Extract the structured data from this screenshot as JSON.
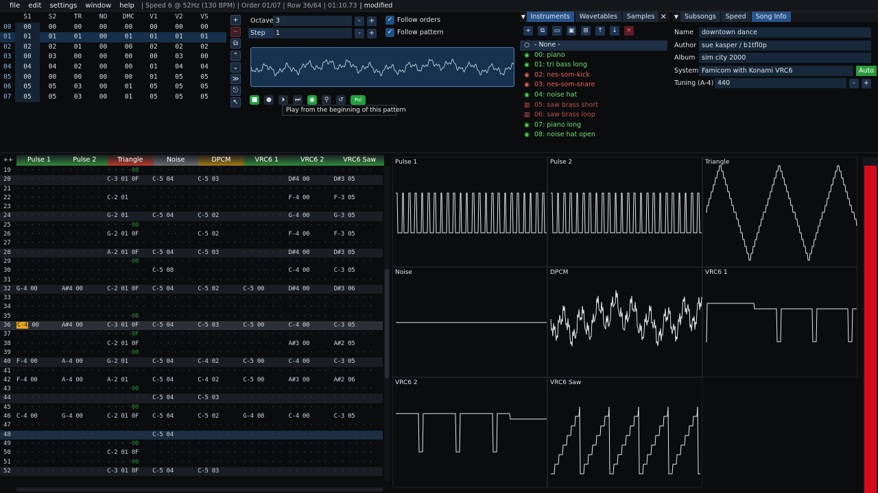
{
  "menubar": {
    "items": [
      "file",
      "edit",
      "settings",
      "window",
      "help"
    ],
    "status": "| Speed 6 @ 52Hz (130 BPM) | Order 01/07 | Row 36/64 | 01:10.73",
    "modified": "| modified"
  },
  "orders": {
    "headers": [
      "S1",
      "S2",
      "TR",
      "NO",
      "DMC",
      "V1",
      "V2",
      "VS"
    ],
    "rows": [
      {
        "n": "00",
        "v": [
          "00",
          "00",
          "00",
          "00",
          "00",
          "00",
          "00",
          "00"
        ]
      },
      {
        "n": "01",
        "v": [
          "01",
          "01",
          "01",
          "00",
          "01",
          "01",
          "01",
          "01"
        ]
      },
      {
        "n": "02",
        "v": [
          "02",
          "02",
          "01",
          "00",
          "00",
          "02",
          "02",
          "02"
        ]
      },
      {
        "n": "03",
        "v": [
          "00",
          "03",
          "00",
          "00",
          "00",
          "00",
          "03",
          "00"
        ]
      },
      {
        "n": "04",
        "v": [
          "04",
          "04",
          "02",
          "00",
          "00",
          "01",
          "04",
          "04"
        ]
      },
      {
        "n": "05",
        "v": [
          "00",
          "00",
          "00",
          "00",
          "00",
          "01",
          "05",
          "05"
        ]
      },
      {
        "n": "06",
        "v": [
          "05",
          "05",
          "03",
          "00",
          "01",
          "05",
          "05",
          "05"
        ]
      },
      {
        "n": "07",
        "v": [
          "05",
          "05",
          "03",
          "00",
          "01",
          "05",
          "05",
          "05"
        ]
      }
    ],
    "selected_row": 1
  },
  "order_buttons": [
    "+",
    "−",
    "⧉",
    "⌃",
    "⌄",
    "≫",
    "⎋",
    "↖"
  ],
  "octave": {
    "label": "Octave",
    "value": "3"
  },
  "step": {
    "label": "Step",
    "value": "1"
  },
  "follow_orders": "Follow orders",
  "follow_pattern": "Follow pattern",
  "tooltip": "Play from the beginning of this pattern",
  "transport": [
    "■",
    "●",
    "⏵",
    "⏭",
    "◉",
    "⚲",
    "↺",
    "Pol"
  ],
  "instr_tabs": [
    "Instruments",
    "Wavetables",
    "Samples"
  ],
  "instr_close": "✕",
  "instr_tools": [
    "+",
    "⧉",
    "▭",
    "▣",
    "⊞",
    "↑",
    "↓",
    "✕"
  ],
  "instruments": [
    {
      "icon": "○",
      "name": "- None -",
      "color": "#e8e8e8",
      "icolor": "#e8e8e8"
    },
    {
      "icon": "◉",
      "name": "00: piano",
      "color": "#6fe06f",
      "icolor": "#4cd94c"
    },
    {
      "icon": "◉",
      "name": "01: tri bass long",
      "color": "#6fe06f",
      "icolor": "#4cd94c"
    },
    {
      "icon": "◉",
      "name": "02: nes-som-kick",
      "color": "#e8605a",
      "icolor": "#e8605a"
    },
    {
      "icon": "◉",
      "name": "03: nes-som-snare",
      "color": "#e8605a",
      "icolor": "#e8605a"
    },
    {
      "icon": "◉",
      "name": "04: noise hat",
      "color": "#6fe06f",
      "icolor": "#4cd94c"
    },
    {
      "icon": "▥",
      "name": "05: saw brass short",
      "color": "#b8524a",
      "icolor": "#d9544a"
    },
    {
      "icon": "▥",
      "name": "06: saw brass loop",
      "color": "#b8524a",
      "icolor": "#d9544a"
    },
    {
      "icon": "◉",
      "name": "07: piano long",
      "color": "#6fe06f",
      "icolor": "#4cd94c"
    },
    {
      "icon": "◉",
      "name": "08: noise hat open",
      "color": "#6fe06f",
      "icolor": "#4cd94c"
    }
  ],
  "song_tabs": [
    "Subsongs",
    "Speed",
    "Song Info"
  ],
  "song_info": {
    "name_label": "Name",
    "name": "downtown dance",
    "author_label": "Author",
    "author": "sue kasper / b1tfl0p",
    "album_label": "Album",
    "album": "sim city 2000",
    "system_label": "System",
    "system": "Famicom with Konami VRC6",
    "auto": "Auto",
    "tuning_label": "Tuning (A-4)",
    "tuning": "440"
  },
  "pattern": {
    "corner": "++",
    "channels": [
      {
        "name": "Pulse 1",
        "color": "#2e8a3a"
      },
      {
        "name": "Pulse 2",
        "color": "#2e8a3a"
      },
      {
        "name": "Triangle",
        "color": "#b83a2c"
      },
      {
        "name": "Noise",
        "color": "#6a6e74"
      },
      {
        "name": "DPCM",
        "color": "#a07a10"
      },
      {
        "name": "VRC6 1",
        "color": "#2e8a3a"
      },
      {
        "name": "VRC6 2",
        "color": "#2e8a3a"
      },
      {
        "name": "VRC6 Saw",
        "color": "#2e8a3a"
      }
    ],
    "rows": [
      {
        "n": "19",
        "c": [
          "· · · · · ·",
          "· · · · · ·",
          "· · · ·08",
          "· · · · · ·",
          "· · · · · ·",
          "· · · · · ·",
          "· · · · · ·",
          "· · · · · ·"
        ]
      },
      {
        "n": "20",
        "c": [
          "· · · · · ·",
          "· · · · · ·",
          "C-3 01 0F",
          "C-5 04",
          "C-5 03",
          "· · · · · ·",
          "D#4 00",
          "D#3 05"
        ]
      },
      {
        "n": "21",
        "c": [
          "· · · · · ·",
          "· · · · · ·",
          "· · · · · ·",
          "· · · · · ·",
          "· · · · · ·",
          "· · · · · ·",
          "· · · · · ·",
          "· · · · · ·"
        ]
      },
      {
        "n": "22",
        "c": [
          "· · · · · ·",
          "· · · · · ·",
          "C-2 01",
          "· · · · · ·",
          "· · · · · ·",
          "· · · · · ·",
          "F-4 00",
          "F-3 05"
        ]
      },
      {
        "n": "23",
        "c": [
          "· · · · · ·",
          "· · · · · ·",
          "· · · · · ·",
          "· · · · · ·",
          "· · · · · ·",
          "· · · · · ·",
          "· · · · · ·",
          "· · · · · ·"
        ]
      },
      {
        "n": "24",
        "c": [
          "· · · · · ·",
          "· · · · · ·",
          "G-2 01",
          "C-5 04",
          "C-5 02",
          "· · · · · ·",
          "G-4 00",
          "G-3 05"
        ]
      },
      {
        "n": "25",
        "c": [
          "· · · · · ·",
          "· · · · · ·",
          "· · · ·00",
          "· · · · · ·",
          "· · · · · ·",
          "· · · · · ·",
          "· · · · · ·",
          "· · · · · ·"
        ]
      },
      {
        "n": "26",
        "c": [
          "· · · · · ·",
          "· · · · · ·",
          "G-2 01 0F",
          "· · · · · ·",
          "C-5 02",
          "· · · · · ·",
          "F-4 00",
          "F-3 05"
        ]
      },
      {
        "n": "27",
        "c": [
          "· · · · · ·",
          "· · · · · ·",
          "· · · · · ·",
          "· · · · · ·",
          "· · · · · ·",
          "· · · · · ·",
          "· · · · · ·",
          "· · · · · ·"
        ]
      },
      {
        "n": "28",
        "c": [
          "· · · · · ·",
          "· · · · · ·",
          "A-2 01 0F",
          "C-5 04",
          "C-5 03",
          "· · · · · ·",
          "D#4 00",
          "D#3 05"
        ]
      },
      {
        "n": "29",
        "c": [
          "· · · · · ·",
          "· · · · · ·",
          "· · · ·00",
          "· · · · · ·",
          "· · · · · ·",
          "· · · · · ·",
          "· · · · · ·",
          "· · · · · ·"
        ]
      },
      {
        "n": "30",
        "c": [
          "· · · · · ·",
          "· · · · · ·",
          "· · · · · ·",
          "C-5 08",
          "· · · · · ·",
          "· · · · · ·",
          "C-4 00",
          "C-3 05"
        ]
      },
      {
        "n": "31",
        "c": [
          "· · · · · ·",
          "· · · · · ·",
          "· · · · · ·",
          "· · · · · ·",
          "· · · · · ·",
          "· · · · · ·",
          "· · · · · ·",
          "· · · · · ·"
        ]
      },
      {
        "n": "32",
        "c": [
          "G-4 00",
          "A#4 00",
          "C-2 01 0F",
          "C-5 04",
          "C-5 02",
          "C-5 00",
          "D#4 00",
          "D#3 06"
        ]
      },
      {
        "n": "33",
        "c": [
          "· · · · · ·",
          "· · · · · ·",
          "· · · · · ·",
          "· · · · · ·",
          "· · · · · ·",
          "· · · · · ·",
          "· · · · · ·",
          "· · · · · ·"
        ]
      },
      {
        "n": "34",
        "c": [
          "· · · · · ·",
          "· · · · · ·",
          "· · · · · ·",
          "· · · · · ·",
          "· · · · · ·",
          "· · · · · ·",
          "· · · · · ·",
          "· · · · · ·"
        ]
      },
      {
        "n": "35",
        "c": [
          "· · · · · ·",
          "· · · · · ·",
          "· · · ·08",
          "· · · · · ·",
          "· · · · · ·",
          "· · · · · ·",
          "· · · · · ·",
          "· · · · · ·"
        ]
      },
      {
        "n": "36",
        "c": [
          "G-4 00",
          "A#4 00",
          "C-3 01 0F",
          "C-5 04",
          "C-5 03",
          "C-5 00",
          "C-4 00",
          "C-3 05"
        ]
      },
      {
        "n": "37",
        "c": [
          "· · · · · ·",
          "· · · · · ·",
          "· · · ·0F",
          "· · · · · ·",
          "· · · · · ·",
          "· · · · · ·",
          "· · · · · ·",
          "· · · · · ·"
        ]
      },
      {
        "n": "38",
        "c": [
          "· · · · · ·",
          "· · · · · ·",
          "C-2 01 0F",
          "· · · · · ·",
          "· · · · · ·",
          "· · · · · ·",
          "A#3 00",
          "A#2 05"
        ]
      },
      {
        "n": "39",
        "c": [
          "· · · · · ·",
          "· · · · · ·",
          "· · · ·00",
          "· · · · · ·",
          "· · · · · ·",
          "· · · · · ·",
          "· · · · · ·",
          "· · · · · ·"
        ]
      },
      {
        "n": "40",
        "c": [
          "F-4 00",
          "A-4 00",
          "G-2 01",
          "C-5 04",
          "C-4 02",
          "C-5 00",
          "C-4 00",
          "C-3 05"
        ]
      },
      {
        "n": "41",
        "c": [
          "· · · · · ·",
          "· · · · · ·",
          "· · · · · ·",
          "· · · · · ·",
          "· · · · · ·",
          "· · · · · ·",
          "· · · · · ·",
          "· · · · · ·"
        ]
      },
      {
        "n": "42",
        "c": [
          "F-4 00",
          "A-4 00",
          "A-2 01",
          "C-5 04",
          "C-4 02",
          "C-5 00",
          "A#3 00",
          "A#2 06"
        ]
      },
      {
        "n": "43",
        "c": [
          "· · · · · ·",
          "· · · · · ·",
          "· · · ·00",
          "· · · · · ·",
          "· · · · · ·",
          "· · · · · ·",
          "· · · · · ·",
          "· · · · · ·"
        ]
      },
      {
        "n": "44",
        "c": [
          "· · · · · ·",
          "· · · · · ·",
          "· · · · · ·",
          "C-5 04",
          "C-5 03",
          "· · · · · ·",
          "· · · · · ·",
          "· · · · · ·"
        ]
      },
      {
        "n": "45",
        "c": [
          "· · · · · ·",
          "· · · · · ·",
          "· · · ·00",
          "· · · · · ·",
          "· · · · · ·",
          "· · · · · ·",
          "· · · · · ·",
          "· · · · · ·"
        ]
      },
      {
        "n": "46",
        "c": [
          "C-4 00",
          "G-4 00",
          "C-2 01 0F",
          "C-5 04",
          "C-5 02",
          "G-4 08",
          "C-4 00",
          "C-3 05"
        ]
      },
      {
        "n": "47",
        "c": [
          "· · · · · ·",
          "· · · · · ·",
          "· · · · · ·",
          "· · · · · ·",
          "· · · · · ·",
          "· · · · · ·",
          "· · · · · ·",
          "· · · · · ·"
        ]
      },
      {
        "n": "48",
        "c": [
          "· · · · · ·",
          "· · · · · ·",
          "· · · · · ·",
          "C-5 04",
          "· · · · · ·",
          "· · · · · ·",
          "· · · · · ·",
          "· · · · · ·"
        ]
      },
      {
        "n": "49",
        "c": [
          "· · · · · ·",
          "· · · · · ·",
          "· · · ·00",
          "· · · · · ·",
          "· · · · · ·",
          "· · · · · ·",
          "· · · · · ·",
          "· · · · · ·"
        ]
      },
      {
        "n": "50",
        "c": [
          "· · · · · ·",
          "· · · · · ·",
          "C-2 01 0F",
          "· · · · · ·",
          "· · · · · ·",
          "· · · · · ·",
          "· · · · · ·",
          "· · · · · ·"
        ]
      },
      {
        "n": "51",
        "c": [
          "· · · · · ·",
          "· · · · · ·",
          "· · · ·00",
          "· · · · · ·",
          "· · · · · ·",
          "· · · · · ·",
          "· · · · · ·",
          "· · · · · ·"
        ]
      },
      {
        "n": "52",
        "c": [
          "· · · · · ·",
          "· · · · · ·",
          "C-3 01 0F",
          "C-5 04",
          "C-5 03",
          "· · · · · ·",
          "· · · · · ·",
          "· · · · · ·"
        ]
      }
    ],
    "cursor_row": "36",
    "cursor_note": "C-4"
  },
  "oscilloscopes": [
    "Pulse 1",
    "Pulse 2",
    "Triangle",
    "Noise",
    "DPCM",
    "VRC6 1",
    "VRC6 2",
    "VRC6 Saw"
  ]
}
